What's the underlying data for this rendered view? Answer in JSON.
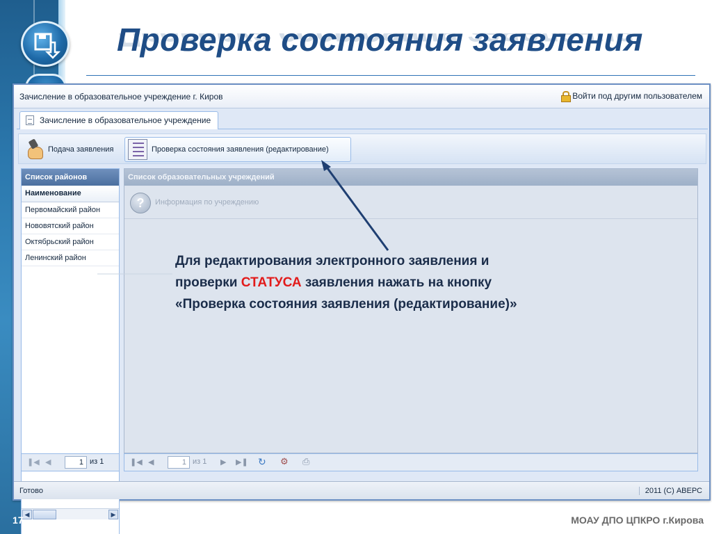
{
  "slide": {
    "title": "Проверка состояния заявления",
    "page_number": "17",
    "footer": "МОАУ ДПО ЦПКРО г.Кирова"
  },
  "app": {
    "title": "Зачисление в образовательное учреждение г. Киров",
    "login_link": "Войти под другим пользователем",
    "tab_label": "Зачисление в образовательное учреждение",
    "toolbar": {
      "submit_label": "Подача заявления",
      "check_label": "Проверка состояния заявления (редактирование)"
    },
    "districts": {
      "title": "Список районов",
      "column": "Наименование",
      "items": [
        "Первомайский район",
        "Нововятский район",
        "Октябрьский район",
        "Ленинский район"
      ]
    },
    "institutions": {
      "title": "Список образовательных учреждений",
      "info_label": "Информация по учреждению"
    },
    "pager": {
      "page": "1",
      "of_label": "из 1"
    },
    "status": {
      "left": "Готово",
      "right": "2011 (С) АВЕРС"
    }
  },
  "callout": {
    "line1": "Для редактирования электронного заявления и",
    "line2_before": "проверки ",
    "line2_highlight": "СТАТУСА",
    "line2_after": " заявления нажать на кнопку",
    "line3": "«Проверка состояния заявления (редактирование)»"
  }
}
